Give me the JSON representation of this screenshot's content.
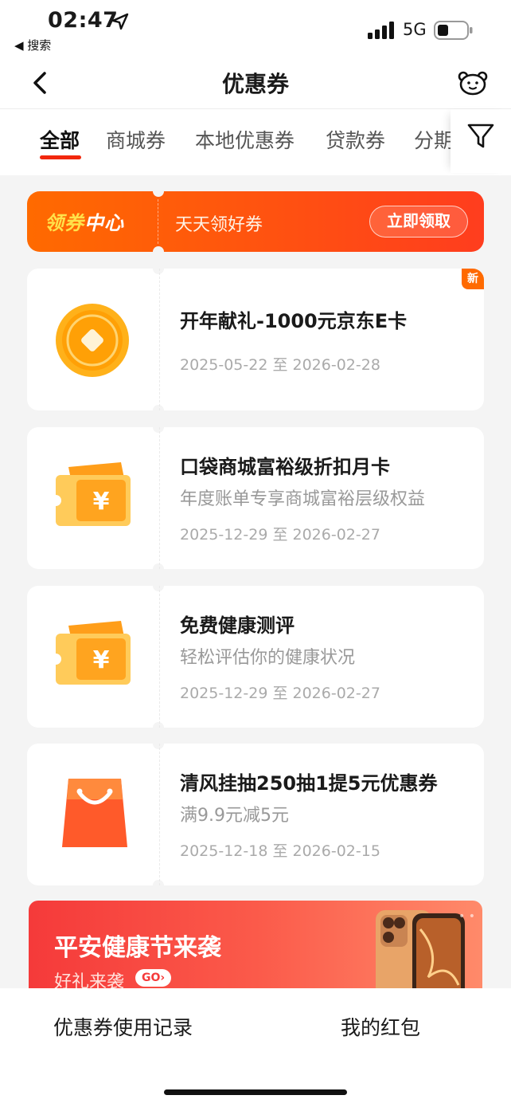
{
  "status_bar": {
    "time": "02:47",
    "back_app": "◀ 搜索",
    "network": "5G"
  },
  "nav": {
    "title": "优惠券"
  },
  "tabs": [
    {
      "label": "全部",
      "active": true
    },
    {
      "label": "商城券",
      "active": false
    },
    {
      "label": "本地优惠券",
      "active": false
    },
    {
      "label": "贷款券",
      "active": false
    },
    {
      "label": "分期",
      "active": false
    }
  ],
  "banner": {
    "logo_a": "领券",
    "logo_b": "中心",
    "slogan": "天天领好券",
    "button": "立即领取"
  },
  "coupons": [
    {
      "title": "开年献礼-1000元京东E卡",
      "desc": "",
      "date": "2025-05-22 至 2026-02-28",
      "badge": "新",
      "icon": "gold-coin-icon"
    },
    {
      "title": "口袋商城富裕级折扣月卡",
      "desc": "年度账单专享商城富裕层级权益",
      "date": "2025-12-29 至 2026-02-27",
      "icon": "ticket-icon"
    },
    {
      "title": "免费健康测评",
      "desc": "轻松评估你的健康状况",
      "date": "2025-12-29 至 2026-02-27",
      "icon": "ticket-icon"
    },
    {
      "title": "清风挂抽250抽1提5元优惠券",
      "desc": "满9.9元减5元",
      "date": "2025-12-18 至 2026-02-15",
      "icon": "shopping-bag-icon"
    }
  ],
  "promo": {
    "title": "平安健康节来袭",
    "subtitle": "好礼来袭",
    "go": "GO›"
  },
  "bottom": {
    "records": "优惠券使用记录",
    "red_packet": "我的红包"
  },
  "colors": {
    "accent": "#f2270c",
    "orange": "#ff6a00"
  }
}
